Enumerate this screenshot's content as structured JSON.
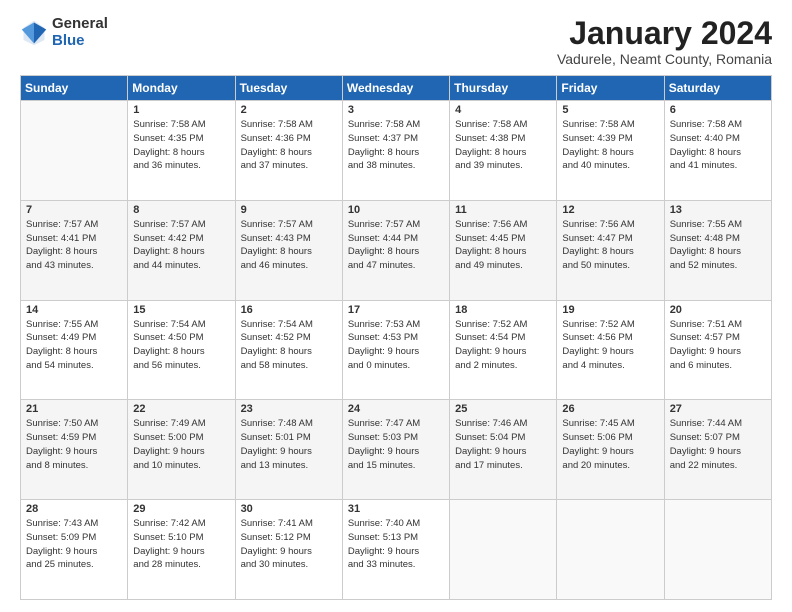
{
  "logo": {
    "general": "General",
    "blue": "Blue"
  },
  "title": {
    "month_year": "January 2024",
    "location": "Vadurele, Neamt County, Romania"
  },
  "headers": [
    "Sunday",
    "Monday",
    "Tuesday",
    "Wednesday",
    "Thursday",
    "Friday",
    "Saturday"
  ],
  "weeks": [
    [
      {
        "day": "",
        "content": ""
      },
      {
        "day": "1",
        "content": "Sunrise: 7:58 AM\nSunset: 4:35 PM\nDaylight: 8 hours\nand 36 minutes."
      },
      {
        "day": "2",
        "content": "Sunrise: 7:58 AM\nSunset: 4:36 PM\nDaylight: 8 hours\nand 37 minutes."
      },
      {
        "day": "3",
        "content": "Sunrise: 7:58 AM\nSunset: 4:37 PM\nDaylight: 8 hours\nand 38 minutes."
      },
      {
        "day": "4",
        "content": "Sunrise: 7:58 AM\nSunset: 4:38 PM\nDaylight: 8 hours\nand 39 minutes."
      },
      {
        "day": "5",
        "content": "Sunrise: 7:58 AM\nSunset: 4:39 PM\nDaylight: 8 hours\nand 40 minutes."
      },
      {
        "day": "6",
        "content": "Sunrise: 7:58 AM\nSunset: 4:40 PM\nDaylight: 8 hours\nand 41 minutes."
      }
    ],
    [
      {
        "day": "7",
        "content": "Sunrise: 7:57 AM\nSunset: 4:41 PM\nDaylight: 8 hours\nand 43 minutes."
      },
      {
        "day": "8",
        "content": "Sunrise: 7:57 AM\nSunset: 4:42 PM\nDaylight: 8 hours\nand 44 minutes."
      },
      {
        "day": "9",
        "content": "Sunrise: 7:57 AM\nSunset: 4:43 PM\nDaylight: 8 hours\nand 46 minutes."
      },
      {
        "day": "10",
        "content": "Sunrise: 7:57 AM\nSunset: 4:44 PM\nDaylight: 8 hours\nand 47 minutes."
      },
      {
        "day": "11",
        "content": "Sunrise: 7:56 AM\nSunset: 4:45 PM\nDaylight: 8 hours\nand 49 minutes."
      },
      {
        "day": "12",
        "content": "Sunrise: 7:56 AM\nSunset: 4:47 PM\nDaylight: 8 hours\nand 50 minutes."
      },
      {
        "day": "13",
        "content": "Sunrise: 7:55 AM\nSunset: 4:48 PM\nDaylight: 8 hours\nand 52 minutes."
      }
    ],
    [
      {
        "day": "14",
        "content": "Sunrise: 7:55 AM\nSunset: 4:49 PM\nDaylight: 8 hours\nand 54 minutes."
      },
      {
        "day": "15",
        "content": "Sunrise: 7:54 AM\nSunset: 4:50 PM\nDaylight: 8 hours\nand 56 minutes."
      },
      {
        "day": "16",
        "content": "Sunrise: 7:54 AM\nSunset: 4:52 PM\nDaylight: 8 hours\nand 58 minutes."
      },
      {
        "day": "17",
        "content": "Sunrise: 7:53 AM\nSunset: 4:53 PM\nDaylight: 9 hours\nand 0 minutes."
      },
      {
        "day": "18",
        "content": "Sunrise: 7:52 AM\nSunset: 4:54 PM\nDaylight: 9 hours\nand 2 minutes."
      },
      {
        "day": "19",
        "content": "Sunrise: 7:52 AM\nSunset: 4:56 PM\nDaylight: 9 hours\nand 4 minutes."
      },
      {
        "day": "20",
        "content": "Sunrise: 7:51 AM\nSunset: 4:57 PM\nDaylight: 9 hours\nand 6 minutes."
      }
    ],
    [
      {
        "day": "21",
        "content": "Sunrise: 7:50 AM\nSunset: 4:59 PM\nDaylight: 9 hours\nand 8 minutes."
      },
      {
        "day": "22",
        "content": "Sunrise: 7:49 AM\nSunset: 5:00 PM\nDaylight: 9 hours\nand 10 minutes."
      },
      {
        "day": "23",
        "content": "Sunrise: 7:48 AM\nSunset: 5:01 PM\nDaylight: 9 hours\nand 13 minutes."
      },
      {
        "day": "24",
        "content": "Sunrise: 7:47 AM\nSunset: 5:03 PM\nDaylight: 9 hours\nand 15 minutes."
      },
      {
        "day": "25",
        "content": "Sunrise: 7:46 AM\nSunset: 5:04 PM\nDaylight: 9 hours\nand 17 minutes."
      },
      {
        "day": "26",
        "content": "Sunrise: 7:45 AM\nSunset: 5:06 PM\nDaylight: 9 hours\nand 20 minutes."
      },
      {
        "day": "27",
        "content": "Sunrise: 7:44 AM\nSunset: 5:07 PM\nDaylight: 9 hours\nand 22 minutes."
      }
    ],
    [
      {
        "day": "28",
        "content": "Sunrise: 7:43 AM\nSunset: 5:09 PM\nDaylight: 9 hours\nand 25 minutes."
      },
      {
        "day": "29",
        "content": "Sunrise: 7:42 AM\nSunset: 5:10 PM\nDaylight: 9 hours\nand 28 minutes."
      },
      {
        "day": "30",
        "content": "Sunrise: 7:41 AM\nSunset: 5:12 PM\nDaylight: 9 hours\nand 30 minutes."
      },
      {
        "day": "31",
        "content": "Sunrise: 7:40 AM\nSunset: 5:13 PM\nDaylight: 9 hours\nand 33 minutes."
      },
      {
        "day": "",
        "content": ""
      },
      {
        "day": "",
        "content": ""
      },
      {
        "day": "",
        "content": ""
      }
    ]
  ]
}
